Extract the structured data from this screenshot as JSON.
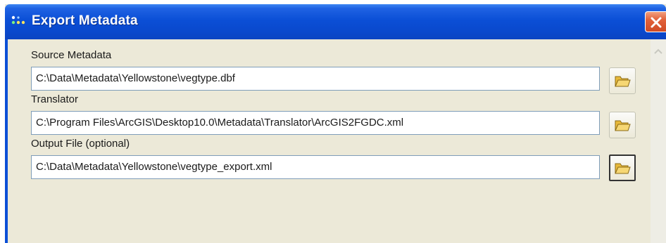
{
  "window": {
    "title": "Export Metadata",
    "icons": {
      "app": "dots-icon",
      "close": "close-icon"
    }
  },
  "fields": [
    {
      "label": "Source Metadata",
      "value": "C:\\Data\\Metadata\\Yellowstone\\vegtype.dbf",
      "browse_icon": "folder-icon"
    },
    {
      "label": "Translator",
      "value": "C:\\Program Files\\ArcGIS\\Desktop10.0\\Metadata\\Translator\\ArcGIS2FGDC.xml",
      "browse_icon": "folder-icon"
    },
    {
      "label": "Output File (optional)",
      "value": "C:\\Data\\Metadata\\Yellowstone\\vegtype_export.xml",
      "browse_icon": "folder-icon"
    }
  ],
  "colors": {
    "titlebar": "#0b4fd6",
    "dialog_bg": "#ece9d8",
    "close_button": "#d9542f"
  }
}
